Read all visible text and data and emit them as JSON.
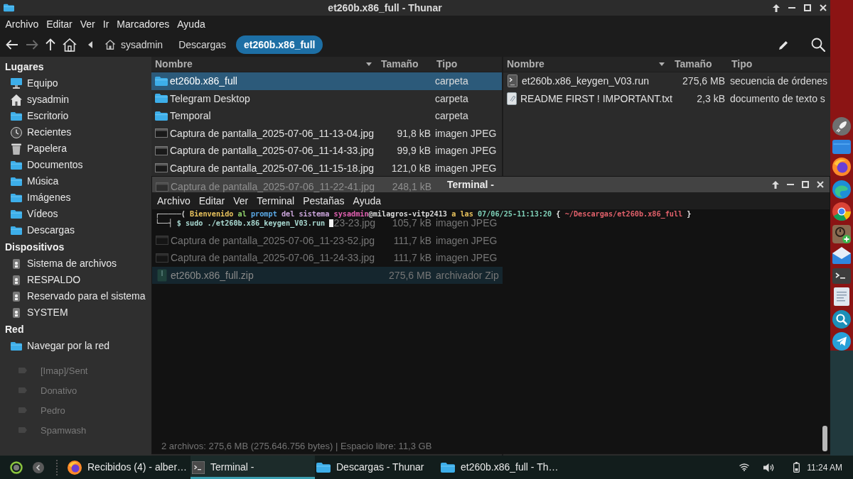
{
  "thunar": {
    "title": "et260b.x86_full - Thunar",
    "menu": [
      "Archivo",
      "Editar",
      "Ver",
      "Ir",
      "Marcadores",
      "Ayuda"
    ],
    "nav_buttons": [
      {
        "kind": "back",
        "disabled": false
      },
      {
        "kind": "forward",
        "disabled": true
      },
      {
        "kind": "up",
        "disabled": false
      },
      {
        "kind": "home",
        "disabled": false
      }
    ],
    "path": [
      {
        "label": "sysadmin",
        "kind": "home",
        "selected": false
      },
      {
        "label": "Descargas",
        "selected": false
      },
      {
        "label": "et260b.x86_full",
        "selected": true
      }
    ],
    "sidebar": {
      "sections": [
        {
          "title": "Lugares",
          "items": [
            {
              "label": "Equipo",
              "kind": "computer"
            },
            {
              "label": "sysadmin",
              "kind": "home"
            },
            {
              "label": "Escritorio",
              "kind": "folder"
            },
            {
              "label": "Recientes",
              "kind": "clock"
            },
            {
              "label": "Papelera",
              "kind": "trash"
            },
            {
              "label": "Documentos",
              "kind": "folder"
            },
            {
              "label": "Música",
              "kind": "folder"
            },
            {
              "label": "Imágenes",
              "kind": "folder"
            },
            {
              "label": "Vídeos",
              "kind": "folder"
            },
            {
              "label": "Descargas",
              "kind": "folder"
            }
          ]
        },
        {
          "title": "Dispositivos",
          "items": [
            {
              "label": "Sistema de archivos",
              "kind": "drive"
            },
            {
              "label": "RESPALDO",
              "kind": "drive"
            },
            {
              "label": "Reservado para el sistema",
              "kind": "drive"
            },
            {
              "label": "SYSTEM",
              "kind": "drive"
            }
          ]
        },
        {
          "title": "Red",
          "items": [
            {
              "label": "Navegar por la red",
              "kind": "folder"
            }
          ]
        }
      ],
      "faded_labels": [
        "[Imap]/Sent",
        "Donativo",
        "Pedro",
        "Spamwash"
      ]
    },
    "panes": [
      {
        "columns": [
          {
            "label": "Nombre",
            "sorted": true
          },
          {
            "label": "Tamaño",
            "sorted": false
          },
          {
            "label": "Tipo",
            "sorted": false
          }
        ],
        "rows": [
          {
            "kind": "folder",
            "name": "et260b.x86_full",
            "type": "carpeta",
            "selected": true
          },
          {
            "kind": "folder",
            "name": "Telegram Desktop",
            "type": "carpeta",
            "selected": false
          },
          {
            "kind": "folder",
            "name": "Temporal",
            "type": "carpeta",
            "selected": false
          },
          {
            "kind": "image",
            "name": "Captura de pantalla_2025-07-06_11-13-04.jpg",
            "size": "91,8 kB",
            "type": "imagen JPEG",
            "selected": false
          },
          {
            "kind": "image",
            "name": "Captura de pantalla_2025-07-06_11-14-33.jpg",
            "size": "99,9 kB",
            "type": "imagen JPEG",
            "selected": false
          },
          {
            "kind": "image",
            "name": "Captura de pantalla_2025-07-06_11-15-18.jpg",
            "size": "121,0 kB",
            "type": "imagen JPEG",
            "selected": false
          },
          {
            "kind": "image",
            "name": "Captura de pantalla_2025-07-06_11-22-41.jpg",
            "size": "248,1 kB",
            "selected": false
          },
          {
            "kind": "partial",
            "name": "23-23.jpg",
            "size": "105,7 kB",
            "type": "imagen JPEG",
            "selected": false
          },
          {
            "kind": "image",
            "name": "Captura de pantalla_2025-07-06_11-23-52.jpg",
            "size": "111,7 kB",
            "type": "imagen JPEG",
            "selected": false
          },
          {
            "kind": "image",
            "name": "Captura de pantalla_2025-07-06_11-24-33.jpg",
            "size": "111,7 kB",
            "type": "imagen JPEG",
            "selected": false
          },
          {
            "kind": "archive",
            "name": "et260b.x86_full.zip",
            "size": "275,6 MB",
            "type": "archivador Zip",
            "selected": true
          }
        ]
      },
      {
        "columns": [
          {
            "label": "Nombre",
            "sorted": true
          },
          {
            "label": "Tamaño",
            "sorted": false
          },
          {
            "label": "Tipo",
            "sorted": false
          }
        ],
        "rows": [
          {
            "kind": "script",
            "name": "et260b.x86_keygen_V03.run",
            "size": "275,6 MB",
            "type": "secuencia de órdenes",
            "selected": false
          },
          {
            "kind": "text",
            "name": "README FIRST ! IMPORTANT.txt",
            "size": "2,3 kB",
            "type": "documento de texto s",
            "selected": false
          }
        ]
      }
    ],
    "status_bar": "2 archivos: 275,6 MB (275.646.756 bytes) | Espacio libre: 11,3 GB"
  },
  "terminal": {
    "title": "Terminal -",
    "menu": [
      "Archivo",
      "Editar",
      "Ver",
      "Terminal",
      "Pestañas",
      "Ayuda"
    ],
    "lines": [
      {
        "segments": [
          {
            "text": "┌─────( ",
            "color": "#d8d8d8"
          },
          {
            "text": "Bienvenido",
            "color": "#e8c25c"
          },
          {
            "text": " al ",
            "color": "#8fd16a"
          },
          {
            "text": "prompt",
            "color": "#5aa9e6"
          },
          {
            "text": " del sistema ",
            "color": "#c9a3d9"
          },
          {
            "text": "sysadmin",
            "color": "#e060b0"
          },
          {
            "text": "@milagros-vitp2413",
            "color": "#d8d8d8"
          },
          {
            "text": " a las ",
            "color": "#e8c25c"
          },
          {
            "text": "07/06/25-11:13:20",
            "color": "#7fd0b8"
          },
          {
            "text": " { ",
            "color": "#eeeeee"
          },
          {
            "text": "~/Descargas/et260b.x86_full",
            "color": "#e0606a"
          },
          {
            "text": " }",
            "color": "#eeeeee"
          }
        ],
        "cursor": false
      },
      {
        "segments": [
          {
            "text": "└──┤ ",
            "color": "#d8d8d8"
          },
          {
            "text": "$ sudo ./et260b.x86_keygen_V03.run ",
            "color": "#a8d8d0"
          }
        ],
        "cursor": true
      }
    ]
  },
  "taskbar": {
    "items": [
      {
        "label": "Recibidos (4) - alber…",
        "kind": "browser",
        "selected": false
      },
      {
        "label": "Terminal -",
        "kind": "terminal",
        "selected": true
      },
      {
        "label": "Descargas - Thunar",
        "kind": "folder",
        "selected": false
      },
      {
        "label": "et260b.x86_full - Th…",
        "kind": "folder",
        "selected": false
      }
    ],
    "clock": "11:24 AM"
  },
  "dock": {
    "items": [
      {
        "kind": "rocket"
      },
      {
        "kind": "folder"
      },
      {
        "kind": "flame"
      },
      {
        "kind": "wave"
      },
      {
        "kind": "segmented"
      },
      {
        "kind": "clock-plus"
      },
      {
        "kind": "envelope"
      },
      {
        "kind": "terminal"
      },
      {
        "kind": "document"
      },
      {
        "kind": "search"
      },
      {
        "kind": "plane"
      }
    ]
  }
}
